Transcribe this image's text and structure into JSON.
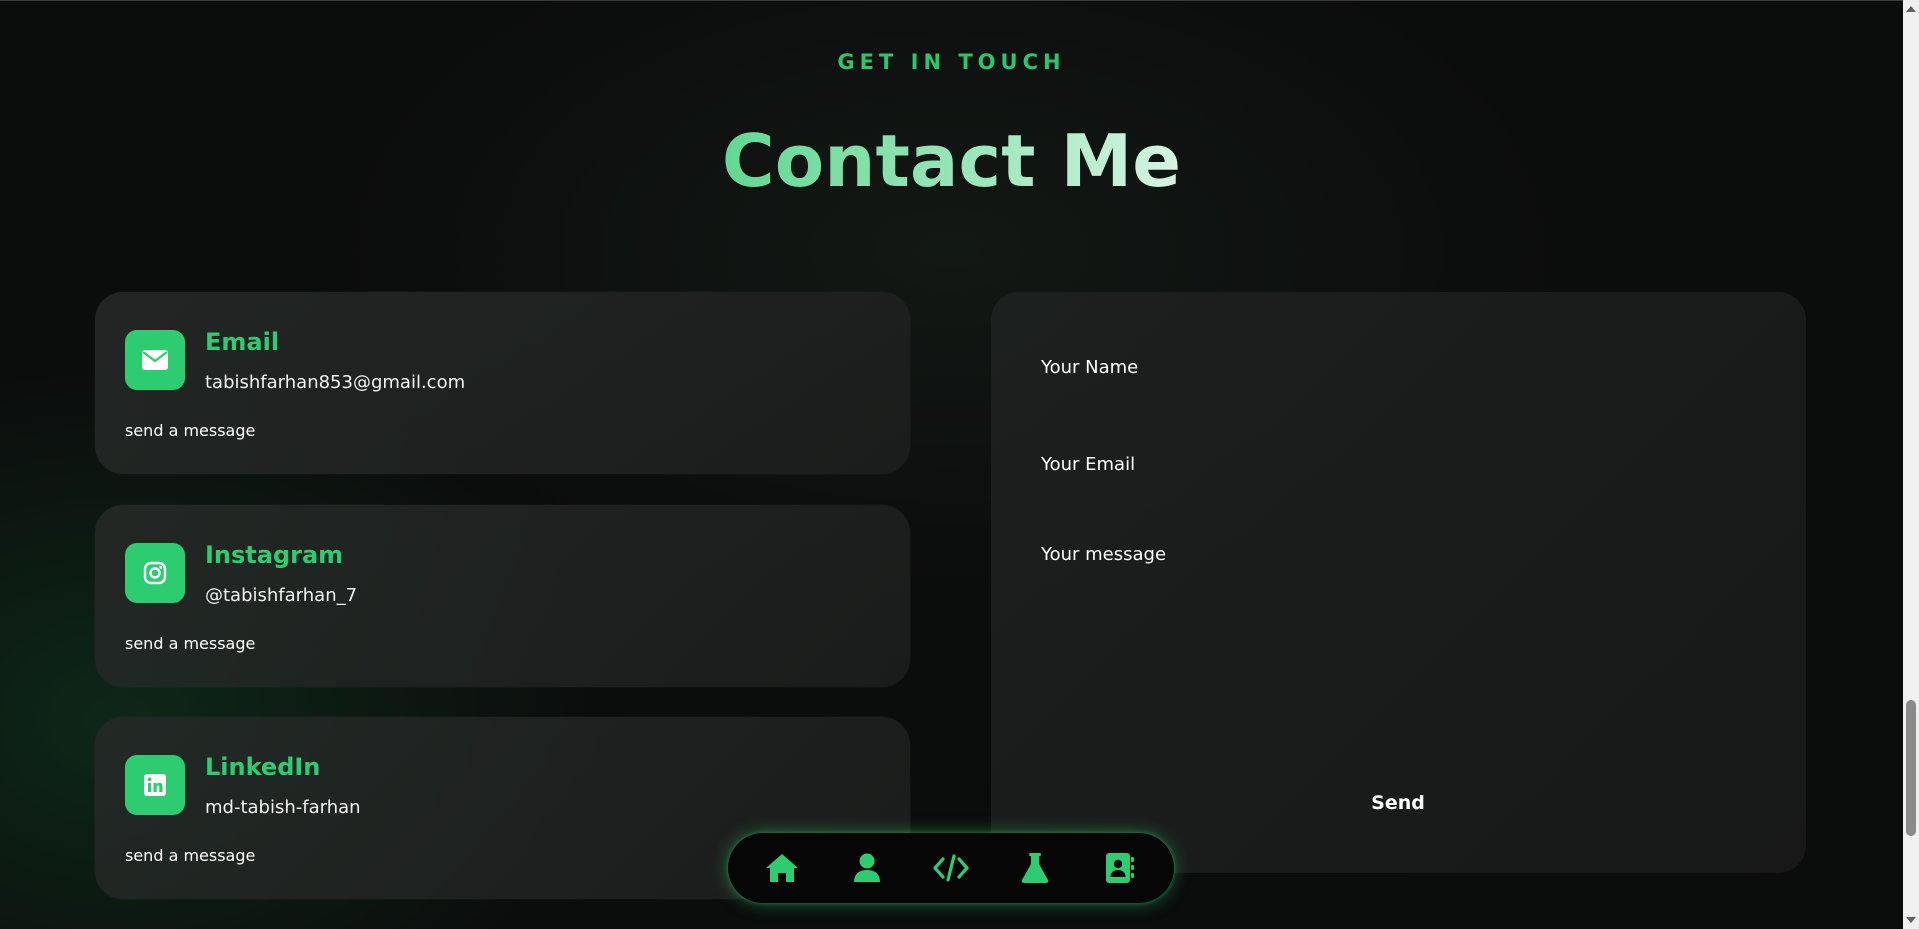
{
  "section": {
    "eyebrow": "GET IN TOUCH",
    "title": "Contact Me"
  },
  "contact_cards": [
    {
      "icon": "envelope-icon",
      "title": "Email",
      "value": "tabishfarhan853@gmail.com",
      "link": "send a message"
    },
    {
      "icon": "instagram-icon",
      "title": "Instagram",
      "value": "@tabishfarhan_7",
      "link": "send a message"
    },
    {
      "icon": "linkedin-icon",
      "title": "LinkedIn",
      "value": "md-tabish-farhan",
      "link": "send a message"
    }
  ],
  "form": {
    "name_placeholder": "Your Name",
    "email_placeholder": "Your Email",
    "message_placeholder": "Your message",
    "send_label": "Send"
  },
  "navbar": {
    "items": [
      {
        "icon": "home-icon"
      },
      {
        "icon": "user-icon"
      },
      {
        "icon": "code-icon"
      },
      {
        "icon": "flask-icon"
      },
      {
        "icon": "contact-book-icon"
      }
    ]
  },
  "colors": {
    "accent": "#2ecc71",
    "background": "#0b0c0c",
    "card": "#1f2221"
  }
}
